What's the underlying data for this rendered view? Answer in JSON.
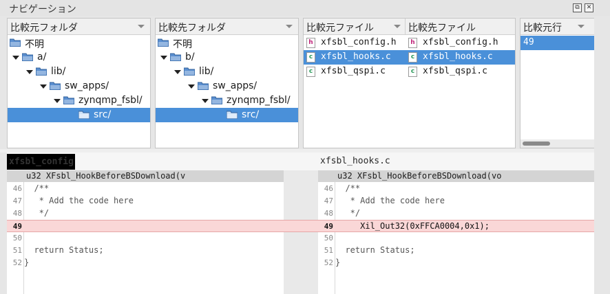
{
  "window": {
    "title": "ナビゲーション"
  },
  "left_tree": {
    "header": "比較元フォルダ",
    "items": [
      {
        "label": "不明",
        "selected": false
      },
      {
        "label": "a/",
        "selected": false
      },
      {
        "label": "lib/",
        "selected": false
      },
      {
        "label": "sw_apps/",
        "selected": false
      },
      {
        "label": "zynqmp_fsbl/",
        "selected": false
      },
      {
        "label": "src/",
        "selected": true
      }
    ]
  },
  "right_tree": {
    "header": "比較先フォルダ",
    "items": [
      {
        "label": "不明",
        "selected": false
      },
      {
        "label": "b/",
        "selected": false
      },
      {
        "label": "lib/",
        "selected": false
      },
      {
        "label": "sw_apps/",
        "selected": false
      },
      {
        "label": "zynqmp_fsbl/",
        "selected": false
      },
      {
        "label": "src/",
        "selected": true
      }
    ]
  },
  "files": {
    "header_left": "比較元ファイル",
    "header_right": "比較先ファイル",
    "rows": [
      {
        "left": "xfsbl_config.h",
        "right": "xfsbl_config.h",
        "left_icon": "h",
        "right_icon": "h",
        "selected": false
      },
      {
        "left": "xfsbl_hooks.c",
        "right": "xfsbl_hooks.c",
        "left_icon": "c",
        "right_icon": "c",
        "selected": true
      },
      {
        "left": "xfsbl_qspi.c",
        "right": "xfsbl_qspi.c",
        "left_icon": "c",
        "right_icon": "c",
        "selected": false
      }
    ]
  },
  "lines_pane": {
    "header": "比較元行",
    "rows": [
      {
        "value": "49",
        "selected": true
      }
    ]
  },
  "icons": {
    "folder": "folder-icon",
    "header_file": "h-file-icon",
    "c_file": "c-file-icon",
    "restore": "restore-icon",
    "close": "close-icon"
  },
  "diff": {
    "left_tab": "xfsbl_config",
    "right_tab": "xfsbl_hooks.c",
    "left": {
      "header": "u32 XFsbl_HookBeforeBSDownload(v",
      "lines": [
        {
          "num": "46",
          "text": "  /**",
          "changed": false
        },
        {
          "num": "47",
          "text": "   * Add the code here",
          "changed": false
        },
        {
          "num": "48",
          "text": "   */",
          "changed": false
        },
        {
          "num": "49",
          "text": "",
          "changed": true
        },
        {
          "num": "50",
          "text": "",
          "changed": false
        },
        {
          "num": "51",
          "text": "  return Status;",
          "changed": false
        },
        {
          "num": "52",
          "text": "}",
          "changed": false
        }
      ]
    },
    "right": {
      "header": "u32 XFsbl_HookBeforeBSDownload(vo",
      "lines": [
        {
          "num": "46",
          "text": "  /**",
          "changed": false
        },
        {
          "num": "47",
          "text": "   * Add the code here",
          "changed": false
        },
        {
          "num": "48",
          "text": "   */",
          "changed": false
        },
        {
          "num": "49",
          "text": "     Xil_Out32(0xFFCA0004,0x1);",
          "changed": true
        },
        {
          "num": "50",
          "text": "",
          "changed": false
        },
        {
          "num": "51",
          "text": "  return Status;",
          "changed": false
        },
        {
          "num": "52",
          "text": "}",
          "changed": false
        }
      ]
    }
  },
  "colors": {
    "selection": "#4a90d9",
    "changed_line": "#fad7d7",
    "folder": "#5b8fd0"
  }
}
